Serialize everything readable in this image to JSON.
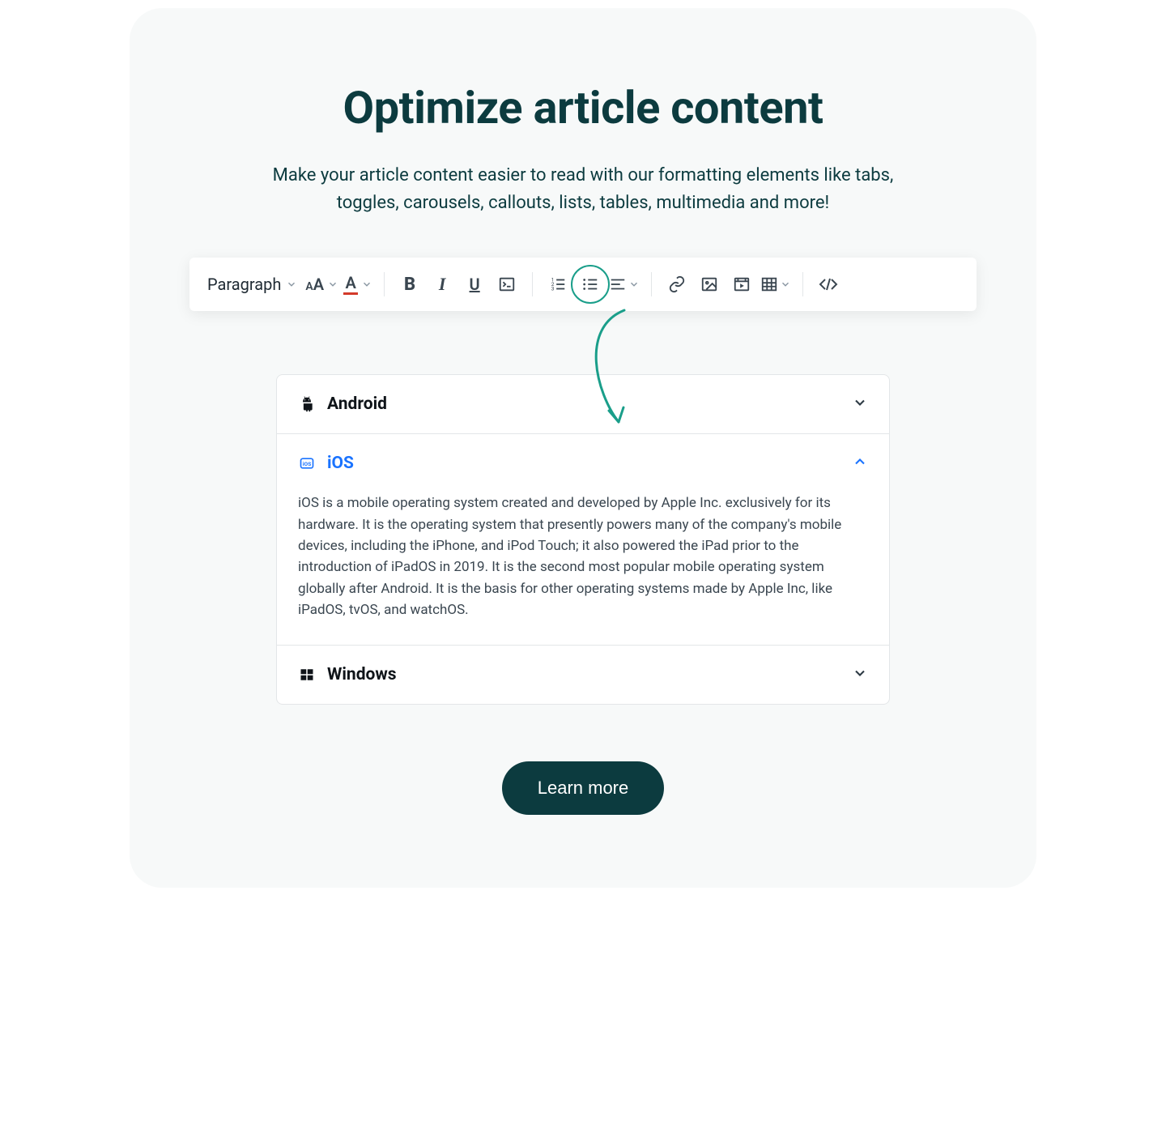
{
  "heading": "Optimize article content",
  "subheading": "Make your article content easier to read with our formatting elements like tabs, toggles, carousels, callouts, lists, tables, multimedia and more!",
  "toolbar": {
    "paragraph_label": "Paragraph"
  },
  "accordion": {
    "items": [
      {
        "title": "Android",
        "expanded": false
      },
      {
        "title": "iOS",
        "expanded": true,
        "body": "iOS is a mobile operating system created and developed by Apple Inc. exclusively for its hardware. It is the operating system that presently powers many of the company's mobile devices, including the iPhone, and iPod Touch; it also powered the iPad prior to the introduction of iPadOS in 2019. It is the second most popular mobile operating system globally after Android. It is the basis for other operating systems made by Apple Inc, like iPadOS, tvOS, and watchOS."
      },
      {
        "title": "Windows",
        "expanded": false
      }
    ]
  },
  "cta_label": "Learn more",
  "colors": {
    "brand_dark": "#0c3b3f",
    "accent_teal": "#1a9e8a",
    "link_blue": "#1a73ff",
    "text_body": "#3a4650"
  }
}
